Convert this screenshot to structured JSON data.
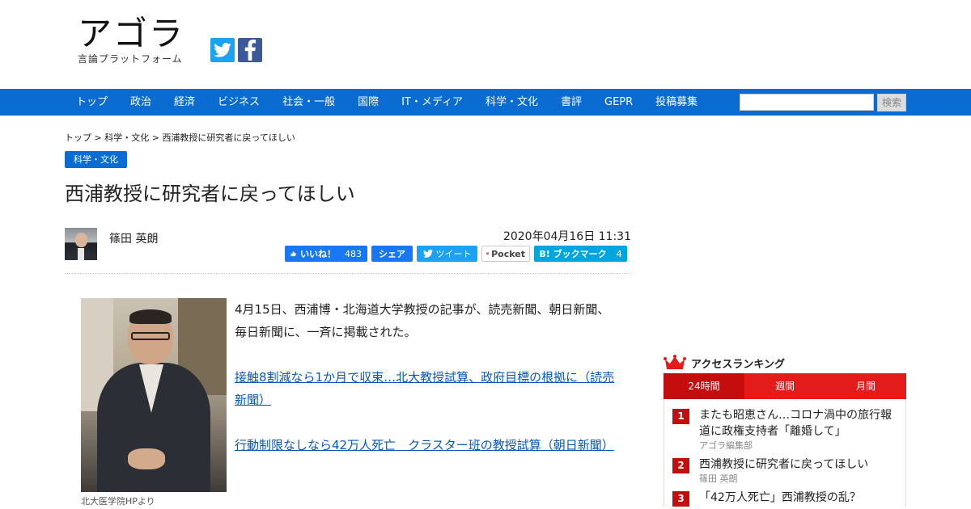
{
  "site": {
    "logo_main": "アゴラ",
    "logo_sub": "言論プラットフォーム",
    "social": [
      {
        "icon": "twitter-icon",
        "color": "#1da1f2"
      },
      {
        "icon": "facebook-icon",
        "color": "#3b5998"
      }
    ]
  },
  "nav": {
    "items": [
      "トップ",
      "政治",
      "経済",
      "ビジネス",
      "社会・一般",
      "国際",
      "IT・メディア",
      "科学・文化",
      "書評",
      "GEPR",
      "投稿募集"
    ],
    "search_placeholder": "",
    "search_button": "検索",
    "color": "#0a6bd1"
  },
  "breadcrumb": {
    "items": [
      "トップ",
      "科学・文化",
      "西浦教授に研究者に戻ってほしい"
    ],
    "separator": " > "
  },
  "article": {
    "category": "科学・文化",
    "title": "西浦教授に研究者に戻ってほしい",
    "author": "篠田 英朗",
    "date": "2020年04月16日 11:31",
    "share": {
      "like_label": "いいね！",
      "like_count": "483",
      "share_label": "シェア",
      "tweet_label": "ツイート",
      "pocket_label": "Pocket",
      "hatena_label": "B! ブックマーク",
      "hatena_count": "4"
    },
    "photo_caption": "北大医学院HPより",
    "paragraphs": [
      "4月15日、西浦博・北海道大学教授の記事が、読売新聞、朝日新聞、毎日新聞に、一斉に掲載された。"
    ],
    "links": [
      "接触8割減なら1か月で収束…北大教授試算、政府目標の根拠に（読売新聞）",
      "行動制限なしなら42万人死亡　クラスター班の教授試算（朝日新聞）"
    ]
  },
  "ranking": {
    "title": "アクセスランキング",
    "tabs": [
      "24時間",
      "週間",
      "月間"
    ],
    "active_tab": "24時間",
    "color": "#e31b1b",
    "items": [
      {
        "rank": "1",
        "headline": "またも昭恵さん…コロナ渦中の旅行報道に政権支持者「離婚して」",
        "author": "アゴラ編集部"
      },
      {
        "rank": "2",
        "headline": "西浦教授に研究者に戻ってほしい",
        "author": "篠田 英朗"
      },
      {
        "rank": "3",
        "headline": "「42万人死亡」西浦教授の乱？",
        "author": ""
      }
    ]
  }
}
